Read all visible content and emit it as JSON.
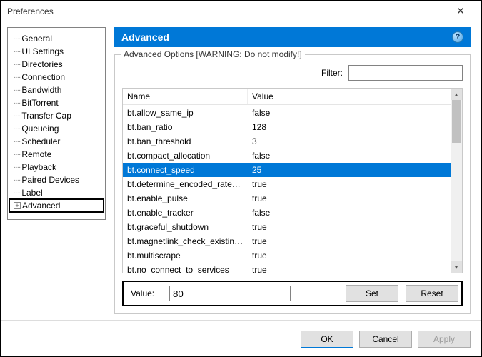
{
  "window": {
    "title": "Preferences",
    "close_glyph": "✕"
  },
  "sidebar": {
    "items": [
      {
        "label": "General"
      },
      {
        "label": "UI Settings"
      },
      {
        "label": "Directories"
      },
      {
        "label": "Connection"
      },
      {
        "label": "Bandwidth"
      },
      {
        "label": "BitTorrent"
      },
      {
        "label": "Transfer Cap"
      },
      {
        "label": "Queueing"
      },
      {
        "label": "Scheduler"
      },
      {
        "label": "Remote"
      },
      {
        "label": "Playback"
      },
      {
        "label": "Paired Devices"
      },
      {
        "label": "Label"
      },
      {
        "label": "Advanced"
      }
    ],
    "selected_index": 13
  },
  "section": {
    "title": "Advanced",
    "help_glyph": "?",
    "groupbox_label": "Advanced Options [WARNING: Do not modify!]",
    "filter_label": "Filter:",
    "filter_value": ""
  },
  "columns": {
    "name": "Name",
    "value": "Value"
  },
  "rows": [
    {
      "name": "bt.allow_same_ip",
      "value": "false"
    },
    {
      "name": "bt.ban_ratio",
      "value": "128"
    },
    {
      "name": "bt.ban_threshold",
      "value": "3"
    },
    {
      "name": "bt.compact_allocation",
      "value": "false"
    },
    {
      "name": "bt.connect_speed",
      "value": "25"
    },
    {
      "name": "bt.determine_encoded_rate_fo...",
      "value": "true"
    },
    {
      "name": "bt.enable_pulse",
      "value": "true"
    },
    {
      "name": "bt.enable_tracker",
      "value": "false"
    },
    {
      "name": "bt.graceful_shutdown",
      "value": "true"
    },
    {
      "name": "bt.magnetlink_check_existing_...",
      "value": "true"
    },
    {
      "name": "bt.multiscrape",
      "value": "true"
    },
    {
      "name": "bt.no_connect_to_services",
      "value": "true"
    }
  ],
  "selected_row": 4,
  "value_editor": {
    "label": "Value:",
    "value": "80",
    "set_label": "Set",
    "reset_label": "Reset"
  },
  "buttons": {
    "ok": "OK",
    "cancel": "Cancel",
    "apply": "Apply"
  }
}
